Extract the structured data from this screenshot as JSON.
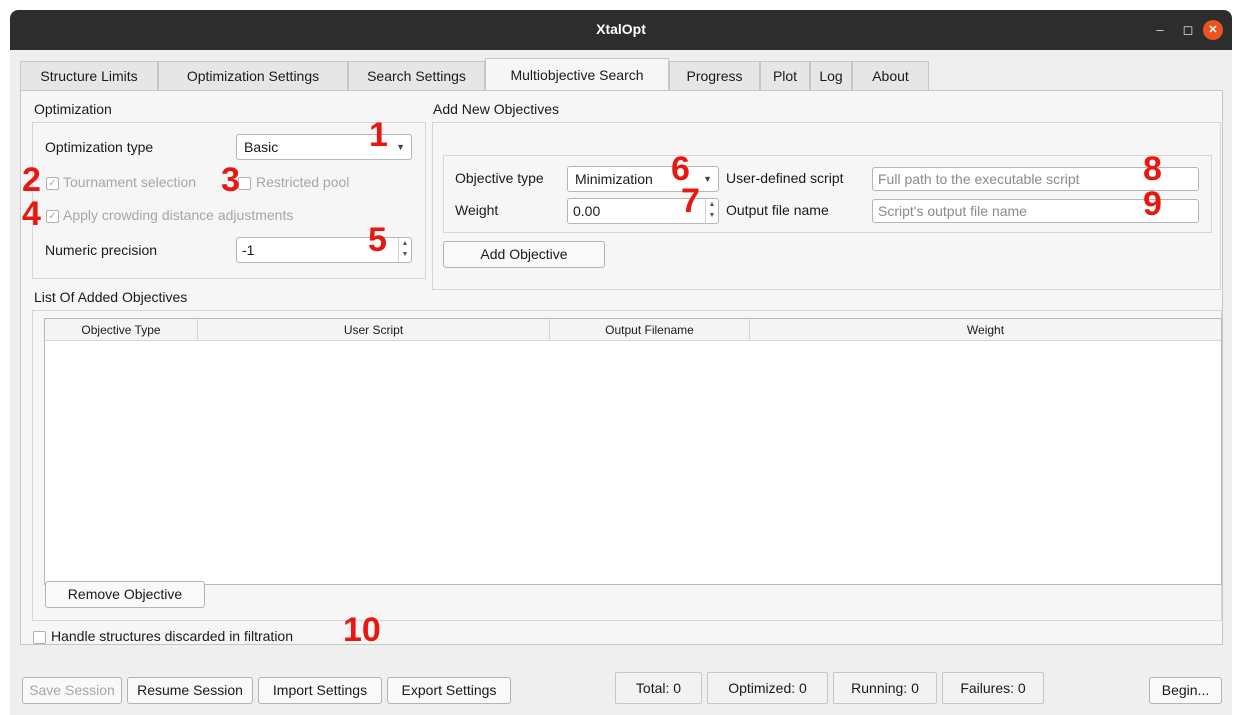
{
  "window": {
    "title": "XtalOpt",
    "minimize_icon": "minimize-icon",
    "maximize_icon": "maximize-icon",
    "close_icon": "close-icon"
  },
  "tabs": [
    {
      "label": "Structure Limits",
      "active": false
    },
    {
      "label": "Optimization Settings",
      "active": false
    },
    {
      "label": "Search Settings",
      "active": false
    },
    {
      "label": "Multiobjective Search",
      "active": true
    },
    {
      "label": "Progress",
      "active": false
    },
    {
      "label": "Plot",
      "active": false
    },
    {
      "label": "Log",
      "active": false
    },
    {
      "label": "About",
      "active": false
    }
  ],
  "optimization": {
    "title": "Optimization",
    "type_label": "Optimization type",
    "type_value": "Basic",
    "tournament_label": "Tournament selection",
    "restricted_label": "Restricted pool",
    "crowding_label": "Apply crowding distance adjustments",
    "precision_label": "Numeric precision",
    "precision_value": "-1"
  },
  "objectives": {
    "title": "Add New Objectives",
    "type_label": "Objective type",
    "type_value": "Minimization",
    "weight_label": "Weight",
    "weight_value": "0.00",
    "script_label": "User-defined script",
    "script_placeholder": "Full path to the executable script",
    "output_label": "Output file name",
    "output_placeholder": "Script's output file name",
    "add_button": "Add Objective"
  },
  "list": {
    "title": "List Of Added Objectives",
    "columns": [
      "Objective Type",
      "User Script",
      "Output Filename",
      "Weight"
    ],
    "rows": [],
    "remove_button": "Remove Objective"
  },
  "filtration_label": "Handle structures discarded in filtration",
  "annotations": [
    "1",
    "2",
    "3",
    "4",
    "5",
    "6",
    "7",
    "8",
    "9",
    "10"
  ],
  "bottom": {
    "save": "Save Session",
    "resume": "Resume Session",
    "import": "Import Settings",
    "export": "Export Settings",
    "total": "Total: 0",
    "optimized": "Optimized: 0",
    "running": "Running: 0",
    "failures": "Failures: 0",
    "begin": "Begin..."
  },
  "colors": {
    "titlebar": "#2d2d2d",
    "close": "#e95420",
    "annotation": "#e8170f"
  }
}
